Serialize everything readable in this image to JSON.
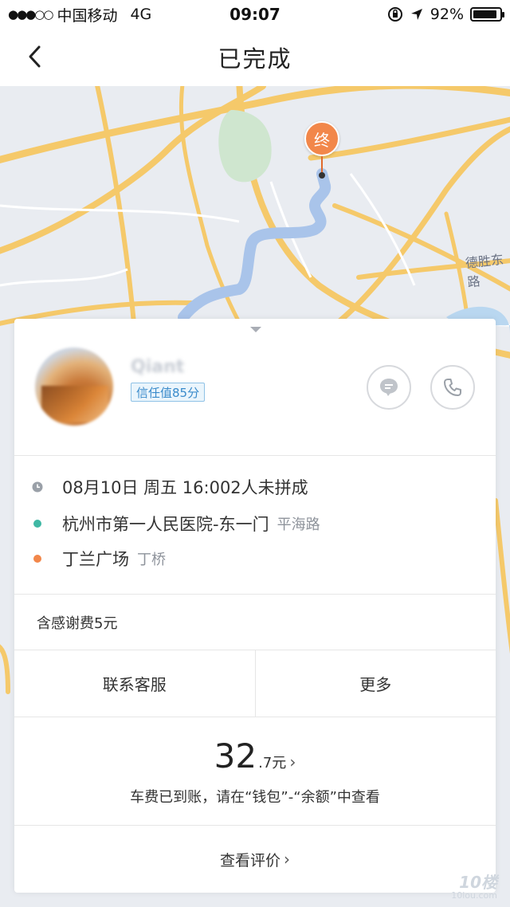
{
  "status_bar": {
    "carrier": "中国移动",
    "network": "4G",
    "time": "09:07",
    "battery": "92%",
    "battery_level": 0.92
  },
  "header": {
    "title": "已完成"
  },
  "map": {
    "road_label": "德胜东路",
    "end_pin": "终"
  },
  "driver": {
    "name": "Qiant",
    "trust_badge": "信任值85分"
  },
  "trip": {
    "time": "08月10日 周五 16:002人未拼成",
    "origin": "杭州市第一人民医院-东一门",
    "origin_area": "平海路",
    "destination": "丁兰广场",
    "destination_area": "丁桥"
  },
  "fee_note": "含感谢费5元",
  "actions": {
    "contact_service": "联系客服",
    "more": "更多"
  },
  "payment": {
    "price_int": "32",
    "price_dec": ".7元",
    "note": "车费已到账，请在“钱包”-“余额”中查看"
  },
  "review": {
    "label": "查看评价"
  },
  "watermark": {
    "main": "10楼",
    "sub": "10lou.com"
  },
  "colors": {
    "origin_dot": "#3fb8a4",
    "destination_dot": "#f2874a",
    "route": "#a9c4ea",
    "road": "#f5c96a"
  }
}
